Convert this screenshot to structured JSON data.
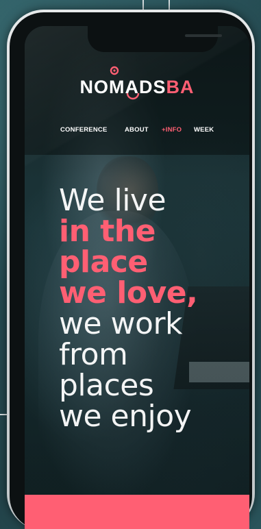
{
  "logo": {
    "part1": "NOMADS",
    "part2": "BA"
  },
  "nav": {
    "conference": "CONFERENCE",
    "about": "ABOUT",
    "info": "+INFO",
    "week": "WEEK"
  },
  "hero": {
    "line1": "We live",
    "line2": "in the",
    "line3": "place",
    "line4": "we love",
    "comma": ",",
    "line5": "we work",
    "line6": "from",
    "line7": "places",
    "line8": "we enjoy"
  },
  "colors": {
    "accent": "#ff5f73",
    "text": "#ffffff",
    "phone_frame": "#cfd4d6"
  },
  "icons": {
    "logo_mark": "location-pin-icon"
  }
}
